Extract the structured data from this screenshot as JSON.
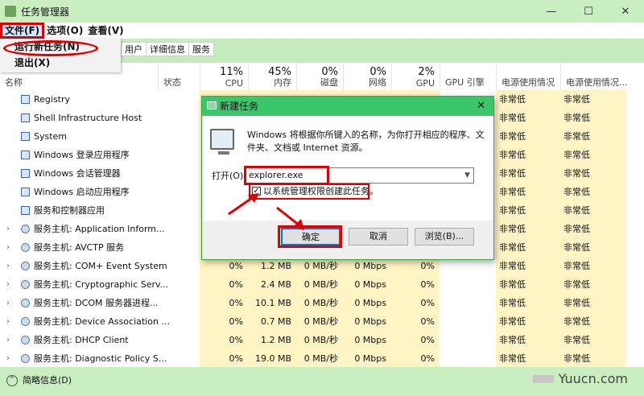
{
  "window": {
    "title": "任务管理器",
    "minimize_glyph": "—",
    "maximize_glyph": "☐",
    "close_glyph": "✕"
  },
  "menubar": {
    "items": [
      "文件(F)",
      "选项(O)",
      "查看(V)"
    ]
  },
  "file_menu": {
    "items": [
      "运行新任务(N)",
      "退出(X)"
    ]
  },
  "tabs": [
    "用户",
    "详细信息",
    "服务"
  ],
  "columns": {
    "name": "名称",
    "status": "状态",
    "cpu": {
      "pct": "11%",
      "label": "CPU"
    },
    "memory": {
      "pct": "45%",
      "label": "内存"
    },
    "disk": {
      "pct": "0%",
      "label": "磁盘"
    },
    "network": {
      "pct": "0%",
      "label": "网络"
    },
    "gpu": {
      "pct": "2%",
      "label": "GPU"
    },
    "gpu_engine": "GPU 引擎",
    "power_usage": "电源使用情况",
    "power_trend": "电源使用情况..."
  },
  "processes": [
    {
      "name": "Registry",
      "expand": false,
      "icon": "window",
      "cpu": "",
      "mem": "",
      "disk": "",
      "net": "",
      "gpu": "",
      "power": "非常低",
      "trend": "非常低"
    },
    {
      "name": "Shell Infrastructure Host",
      "expand": false,
      "icon": "window",
      "cpu": "",
      "mem": "",
      "disk": "",
      "net": "",
      "gpu": "",
      "power": "非常低",
      "trend": "非常低"
    },
    {
      "name": "System",
      "expand": false,
      "icon": "window",
      "cpu": "",
      "mem": "",
      "disk": "",
      "net": "",
      "gpu": "",
      "power": "非常低",
      "trend": "非常低"
    },
    {
      "name": "Windows 登录应用程序",
      "expand": false,
      "icon": "window",
      "cpu": "",
      "mem": "",
      "disk": "",
      "net": "",
      "gpu": "",
      "power": "非常低",
      "trend": "非常低"
    },
    {
      "name": "Windows 会话管理器",
      "expand": false,
      "icon": "window",
      "cpu": "",
      "mem": "",
      "disk": "",
      "net": "",
      "gpu": "",
      "power": "非常低",
      "trend": "非常低"
    },
    {
      "name": "Windows 启动应用程序",
      "expand": false,
      "icon": "window",
      "cpu": "",
      "mem": "",
      "disk": "",
      "net": "",
      "gpu": "",
      "power": "非常低",
      "trend": "非常低"
    },
    {
      "name": "服务和控制器应用",
      "expand": false,
      "icon": "window",
      "cpu": "",
      "mem": "",
      "disk": "",
      "net": "",
      "gpu": "",
      "power": "非常低",
      "trend": "非常低"
    },
    {
      "name": "服务主机: Application Inform...",
      "expand": true,
      "icon": "gear",
      "cpu": "",
      "mem": "",
      "disk": "",
      "net": "",
      "gpu": "",
      "power": "非常低",
      "trend": "非常低"
    },
    {
      "name": "服务主机: AVCTP 服务",
      "expand": true,
      "icon": "gear",
      "cpu": "",
      "mem": "",
      "disk": "",
      "net": "",
      "gpu": "",
      "power": "非常低",
      "trend": "非常低"
    },
    {
      "name": "服务主机: COM+ Event System",
      "expand": true,
      "icon": "gear",
      "cpu": "0%",
      "mem": "1.2 MB",
      "disk": "0 MB/秒",
      "net": "0 Mbps",
      "gpu": "0%",
      "power": "非常低",
      "trend": "非常低"
    },
    {
      "name": "服务主机: Cryptographic Serv...",
      "expand": true,
      "icon": "gear",
      "cpu": "0%",
      "mem": "2.4 MB",
      "disk": "0 MB/秒",
      "net": "0 Mbps",
      "gpu": "0%",
      "power": "非常低",
      "trend": "非常低"
    },
    {
      "name": "服务主机: DCOM 服务器进程...",
      "expand": true,
      "icon": "gear",
      "cpu": "0%",
      "mem": "10.1 MB",
      "disk": "0 MB/秒",
      "net": "0 Mbps",
      "gpu": "0%",
      "power": "非常低",
      "trend": "非常低"
    },
    {
      "name": "服务主机: Device Association ...",
      "expand": true,
      "icon": "gear",
      "cpu": "0%",
      "mem": "0.7 MB",
      "disk": "0 MB/秒",
      "net": "0 Mbps",
      "gpu": "0%",
      "power": "非常低",
      "trend": "非常低"
    },
    {
      "name": "服务主机: DHCP Client",
      "expand": true,
      "icon": "gear",
      "cpu": "0%",
      "mem": "1.2 MB",
      "disk": "0 MB/秒",
      "net": "0 Mbps",
      "gpu": "0%",
      "power": "非常低",
      "trend": "非常低"
    },
    {
      "name": "服务主机: Diagnostic Policy S...",
      "expand": true,
      "icon": "gear",
      "cpu": "0%",
      "mem": "19.0 MB",
      "disk": "0 MB/秒",
      "net": "0 Mbps",
      "gpu": "0%",
      "power": "非常低",
      "trend": "非常低"
    }
  ],
  "statusbar": {
    "fewer_details": "简略信息(D)",
    "watermark": "Yuucn.com"
  },
  "dialog": {
    "title": "新建任务",
    "close_glyph": "✕",
    "description": "Windows 将根据你所键入的名称，为你打开相应的程序、文件夹、文档或 Internet 资源。",
    "open_label": "打开(O):",
    "open_value": "explorer.exe",
    "admin_checkbox_label": "以系统管理权限创建此任务。",
    "admin_checked": "✓",
    "ok": "确定",
    "cancel": "取消",
    "browse": "浏览(B)..."
  },
  "colors": {
    "accent_green": "#3cc66a",
    "highlight_red": "#e00000",
    "column_highlight": "#fff4c4"
  }
}
